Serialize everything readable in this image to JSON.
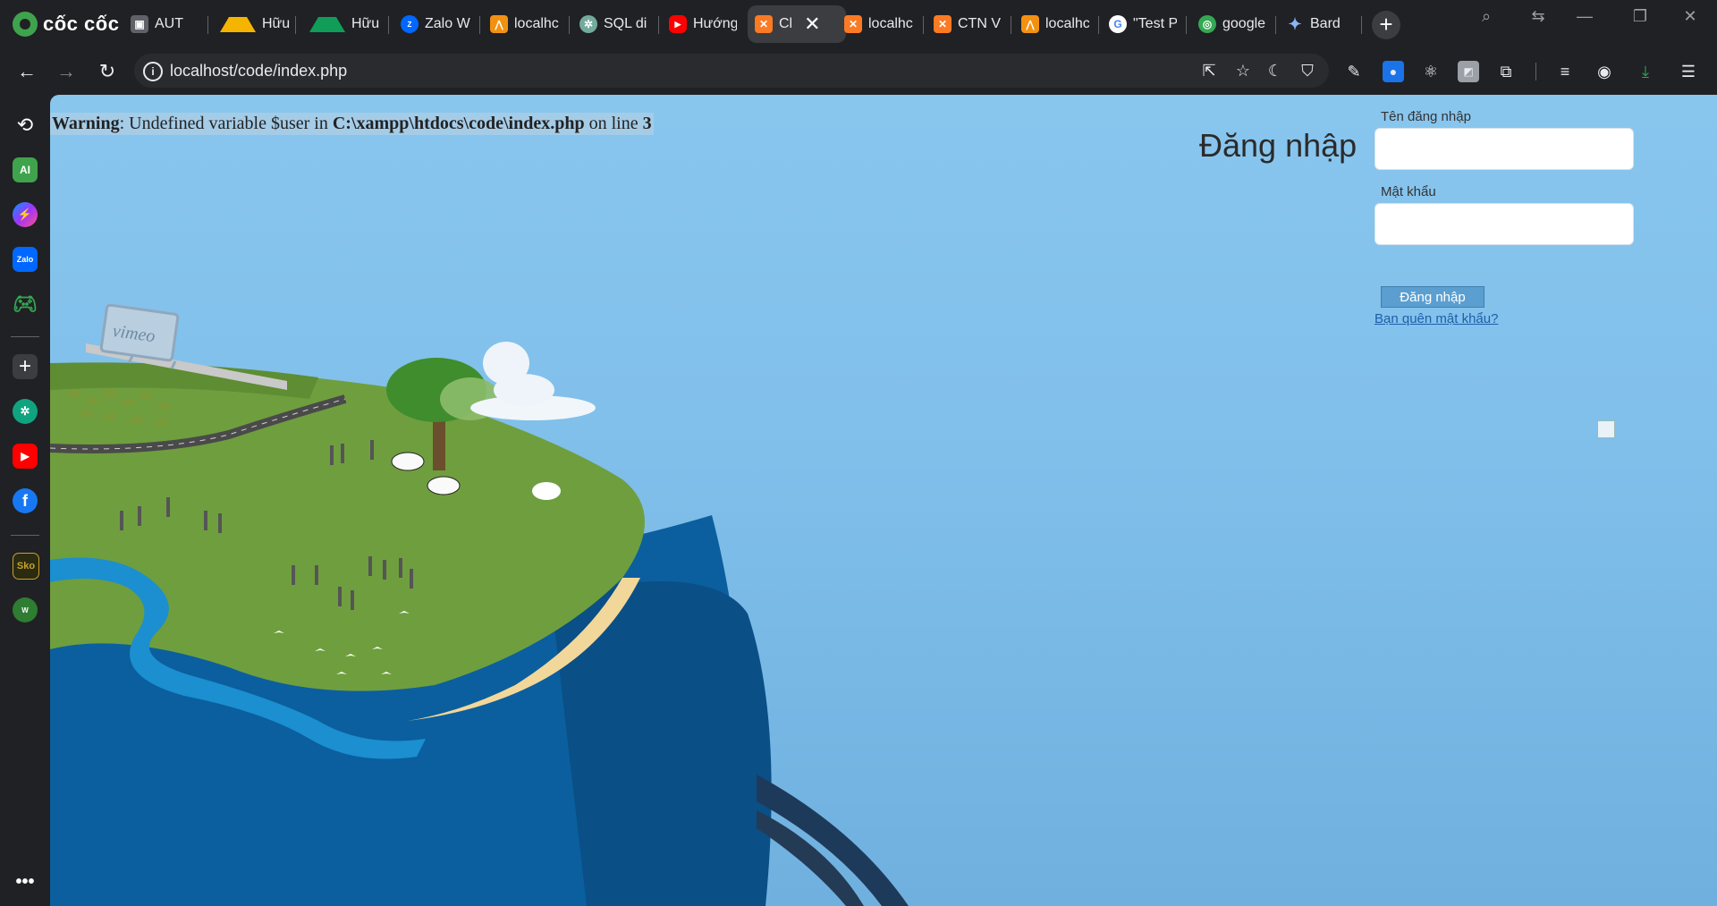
{
  "browser": {
    "brand": "cốc cốc",
    "tabs": [
      {
        "title": "AUT",
        "icon": "account-box-icon"
      },
      {
        "title": "Hữu Đ",
        "icon": "google-drive-icon"
      },
      {
        "title": "Hữu Đ",
        "icon": "google-drive-icon"
      },
      {
        "title": "Zalo W",
        "icon": "zalo-icon"
      },
      {
        "title": "localhc",
        "icon": "phpmyadmin-icon"
      },
      {
        "title": "SQL di",
        "icon": "chatgpt-icon"
      },
      {
        "title": "Hướng",
        "icon": "youtube-icon"
      },
      {
        "title": "Cl",
        "icon": "xampp-icon",
        "active": true
      },
      {
        "title": "localhc",
        "icon": "xampp-icon"
      },
      {
        "title": "CTN V",
        "icon": "xampp-icon"
      },
      {
        "title": "localhc",
        "icon": "phpmyadmin-icon"
      },
      {
        "title": "\"Test P",
        "icon": "google-icon"
      },
      {
        "title": "google",
        "icon": "google-lens-icon"
      },
      {
        "title": "Bard",
        "icon": "bard-icon"
      }
    ],
    "url": "localhost/code/index.php"
  },
  "page": {
    "warning": {
      "label": "Warning",
      "text1": ": Undefined variable $user in ",
      "path": "C:\\xampp\\htdocs\\code\\index.php",
      "text2": " on line ",
      "line": "3"
    },
    "login": {
      "title": "Đăng nhập",
      "username_label": "Tên đăng nhập",
      "username_value": "",
      "password_label": "Mật khẩu",
      "password_value": "",
      "submit_label": "Đăng nhập",
      "forgot_link": "Bạn quên mật khẩu?"
    },
    "billboard_text": "vimeo"
  },
  "colors": {
    "sky": "#84c3ec",
    "hill": "#6f9e3e",
    "ocean": "#0b5f9e",
    "button": "#5b9fd1",
    "link": "#1f5fa8"
  }
}
